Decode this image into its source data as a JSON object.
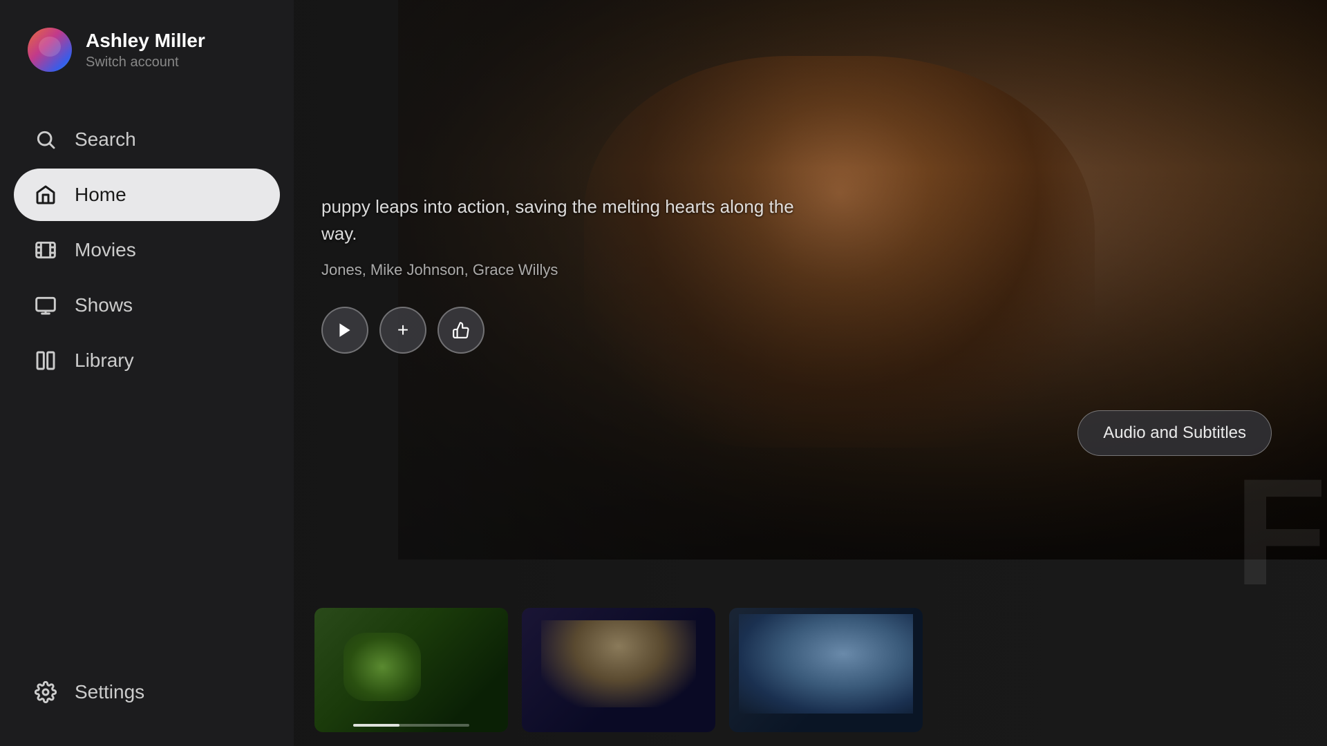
{
  "user": {
    "name": "Ashley Miller",
    "switch_label": "Switch account"
  },
  "nav": {
    "search_label": "Search",
    "home_label": "Home",
    "movies_label": "Movies",
    "shows_label": "Shows",
    "library_label": "Library",
    "settings_label": "Settings",
    "active": "Home"
  },
  "hero": {
    "description": "puppy leaps into action, saving the melting hearts along the way.",
    "cast": "Jones, Mike Johnson, Grace Willys",
    "audio_subtitles_label": "Audio and Subtitles"
  },
  "action_buttons": {
    "play_label": "▶",
    "add_label": "+",
    "like_label": "👍"
  },
  "thumbnails": [
    {
      "id": 1,
      "progress": 40
    },
    {
      "id": 2,
      "progress": 0
    },
    {
      "id": 3,
      "progress": 0
    }
  ],
  "colors": {
    "sidebar_bg": "#1c1c1e",
    "active_item_bg": "#e8e8ea",
    "text_primary": "#ffffff",
    "text_secondary": "#888888"
  }
}
